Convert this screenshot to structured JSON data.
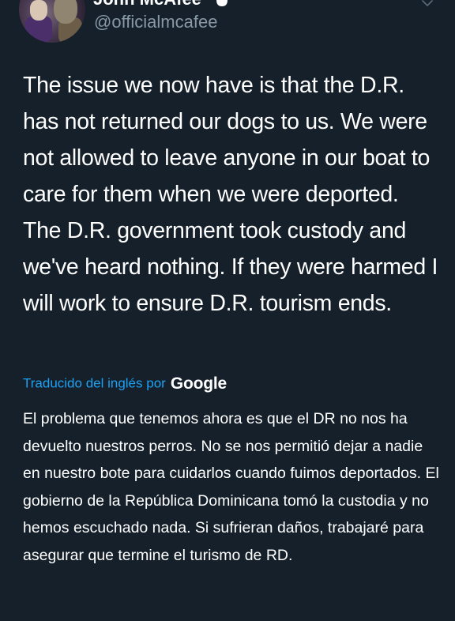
{
  "tweet": {
    "display_name": "John McAfee",
    "handle": "@officialmcafee",
    "text": "The issue we now have is that the D.R. has not returned our dogs to us. We were not allowed to leave anyone in our boat to care for them when we were deported. The D.R. government took custody and we've heard nothing. If they were harmed I will work to ensure D.R. tourism ends.",
    "translation_label": "Traducido del inglés por",
    "translation_brand": "Google",
    "translated_text": "El problema que tenemos ahora es que el DR no nos ha devuelto nuestros perros. No se nos permitió dejar a nadie en nuestro bote para cuidarlos cuando fuimos deportados. El gobierno de la República Dominicana tomó la custodia y no hemos escuchado nada. Si sufrieran daños, trabajaré para asegurar que termine el turismo de RD."
  },
  "icons": {
    "verified": "verified-badge-icon",
    "menu": "chevron-down-icon"
  },
  "colors": {
    "background": "#15202b",
    "text_primary": "#ffffff",
    "text_secondary": "#8899a6",
    "accent": "#1da1f2"
  }
}
